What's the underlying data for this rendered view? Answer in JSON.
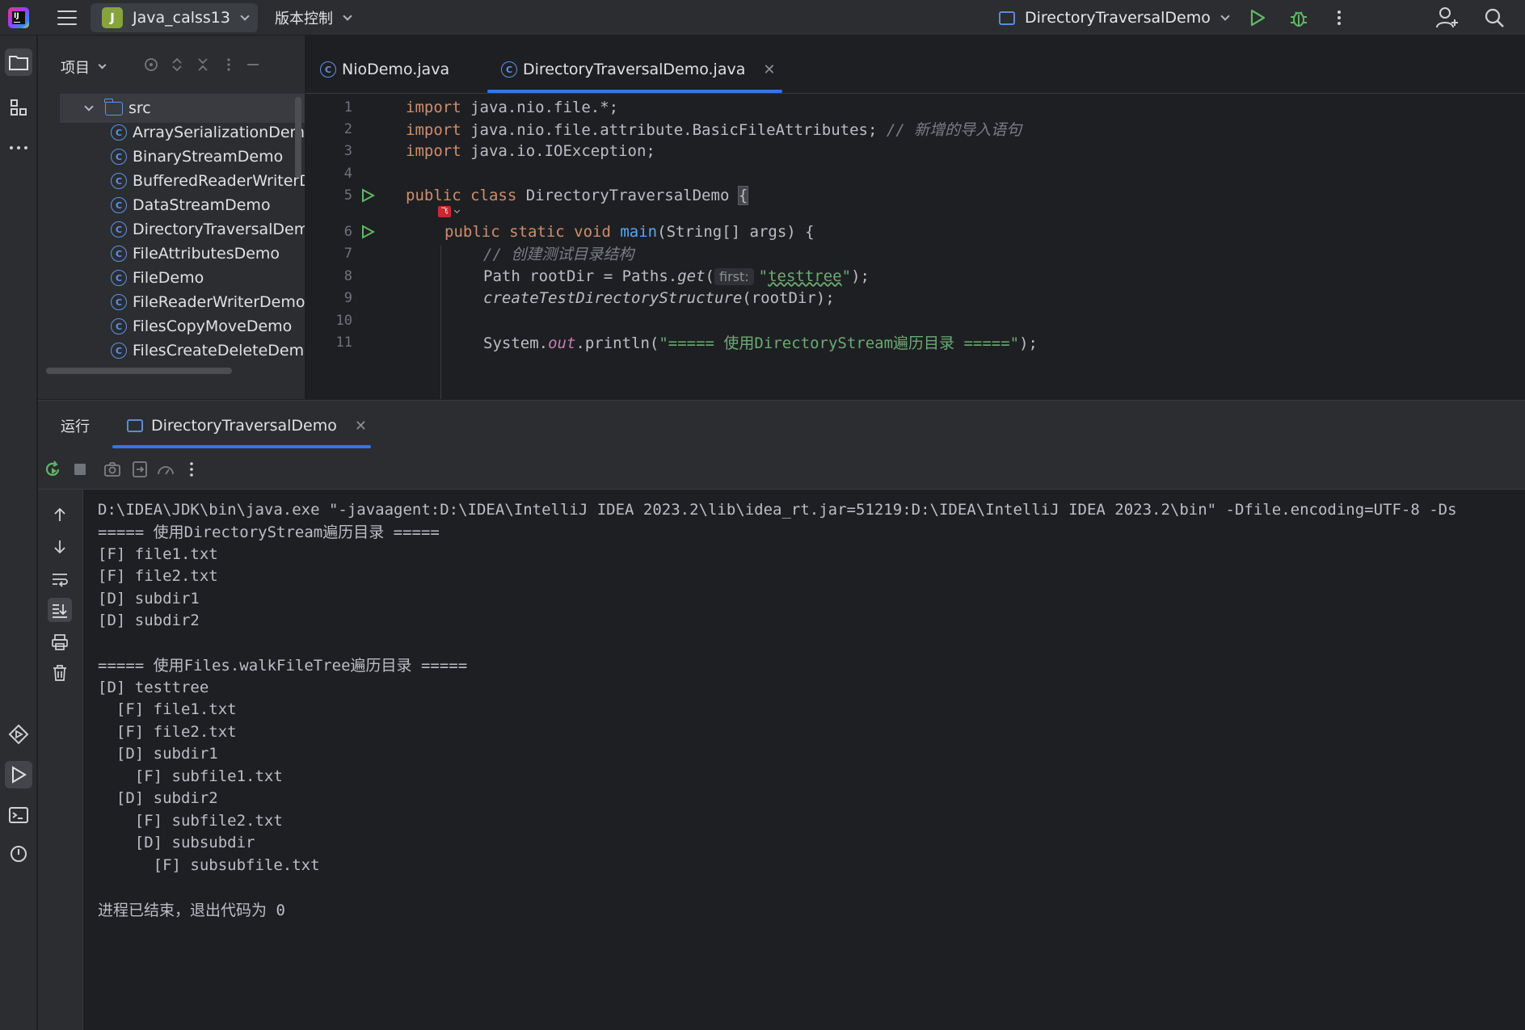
{
  "topbar": {
    "project_badge": "J",
    "project_name": "Java_calss13",
    "vcs_label": "版本控制",
    "run_config": "DirectoryTraversalDemo"
  },
  "project_panel": {
    "title": "项目",
    "tree": [
      {
        "label": "src",
        "kind": "folder"
      },
      {
        "label": "ArraySerializationDemo",
        "kind": "class"
      },
      {
        "label": "BinaryStreamDemo",
        "kind": "class"
      },
      {
        "label": "BufferedReaderWriterDemo",
        "kind": "class"
      },
      {
        "label": "DataStreamDemo",
        "kind": "class"
      },
      {
        "label": "DirectoryTraversalDemo",
        "kind": "class"
      },
      {
        "label": "FileAttributesDemo",
        "kind": "class"
      },
      {
        "label": "FileDemo",
        "kind": "class"
      },
      {
        "label": "FileReaderWriterDemo",
        "kind": "class"
      },
      {
        "label": "FilesCopyMoveDemo",
        "kind": "class"
      },
      {
        "label": "FilesCreateDeleteDemo",
        "kind": "class"
      }
    ]
  },
  "editor": {
    "tabs": [
      {
        "label": "NioDemo.java",
        "active": false
      },
      {
        "label": "DirectoryTraversalDemo.java",
        "active": true
      }
    ],
    "line_numbers": [
      "1",
      "2",
      "3",
      "4",
      "5",
      "6",
      "7",
      "8",
      "9",
      "10",
      "11"
    ],
    "code": {
      "l1_kw": "import",
      "l1_rest": " java.nio.file.*;",
      "l2_kw": "import",
      "l2_rest": " java.nio.file.attribute.BasicFileAttributes; ",
      "l2_comment": "// 新增的导入语句",
      "l3_kw": "import",
      "l3_rest": " java.io.IOException;",
      "l5_kw": "public class",
      "l5_name": " DirectoryTraversalDemo ",
      "l5_brace": "{",
      "l6_kw": "public static void",
      "l6_fn": "main",
      "l6_rest": "(String[] args) {",
      "l7_comment": "// 创建测试目录结构",
      "l8_a": "Path rootDir = Paths.",
      "l8_get": "get",
      "l8_paren": "(",
      "l8_hint": "first:",
      "l8_q1": "\"",
      "l8_str": "testtree",
      "l8_q2": "\"",
      "l8_end": ");",
      "l9_call": "createTestDirectoryStructure",
      "l9_rest": "(rootDir);",
      "l11_a": "System.",
      "l11_out": "out",
      "l11_b": ".println(",
      "l11_str": "\"===== 使用DirectoryStream遍历目录 =====\"",
      "l11_end": ");"
    },
    "inlay_badge": "飞"
  },
  "run_panel": {
    "title": "运行",
    "tab_label": "DirectoryTraversalDemo",
    "output": [
      "D:\\IDEA\\JDK\\bin\\java.exe \"-javaagent:D:\\IDEA\\IntelliJ IDEA 2023.2\\lib\\idea_rt.jar=51219:D:\\IDEA\\IntelliJ IDEA 2023.2\\bin\" -Dfile.encoding=UTF-8 -Ds",
      "===== 使用DirectoryStream遍历目录 =====",
      "[F] file1.txt",
      "[F] file2.txt",
      "[D] subdir1",
      "[D] subdir2",
      "",
      "===== 使用Files.walkFileTree遍历目录 =====",
      "[D] testtree",
      "  [F] file1.txt",
      "  [F] file2.txt",
      "  [D] subdir1",
      "    [F] subfile1.txt",
      "  [D] subdir2",
      "    [F] subfile2.txt",
      "    [D] subsubdir",
      "      [F] subsubfile.txt",
      "",
      "进程已结束，退出代码为 0"
    ]
  },
  "colors": {
    "accent": "#3574f0",
    "keyword": "#cf8e6d",
    "string": "#6aab73",
    "function": "#56a8f5",
    "run_green": "#5fb865"
  }
}
